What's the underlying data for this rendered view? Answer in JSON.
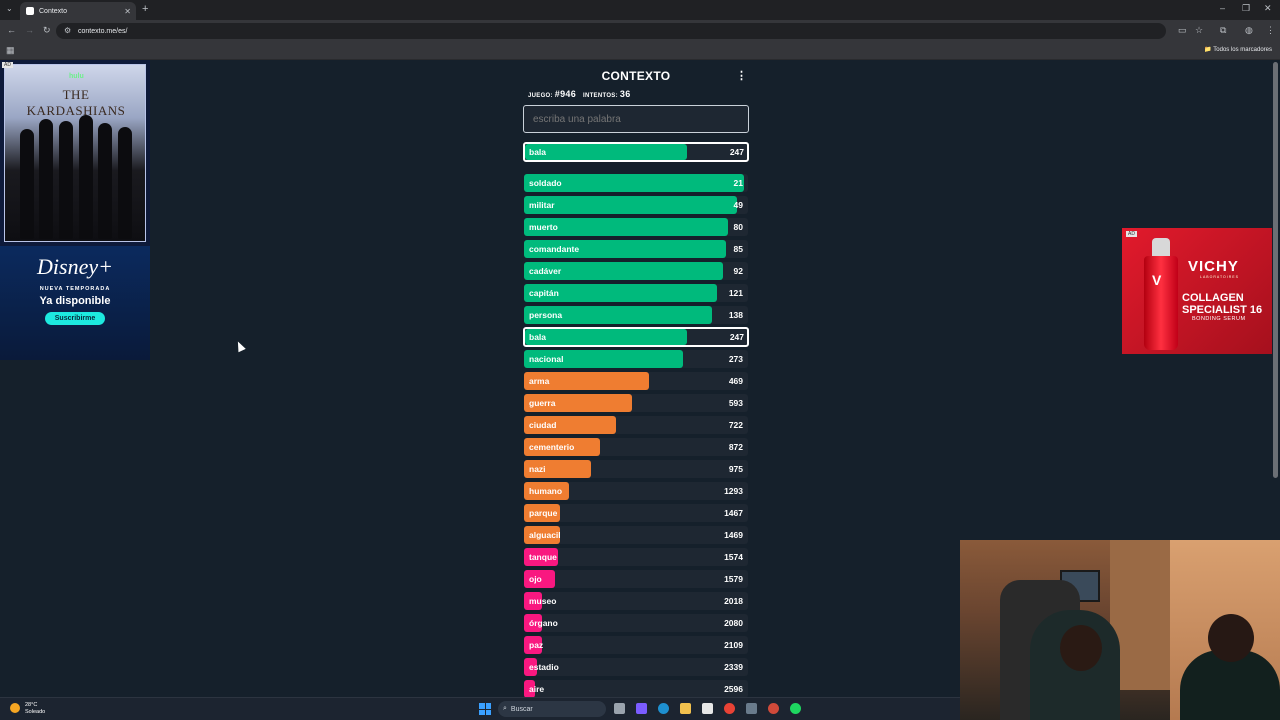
{
  "browser": {
    "tab_title": "Contexto",
    "url": "contexto.me/es/",
    "bookmarks_all": "Todos los marcadores"
  },
  "ads": {
    "left": {
      "tag": "AD",
      "brand": "hulu",
      "show": "THE KARDASHIANS",
      "service": "Disney+",
      "tagline": "NUEVA TEMPORADA",
      "headline": "Ya disponible",
      "cta": "Suscribirme"
    },
    "right": {
      "tag": "AD",
      "brand": "VICHY",
      "sub_brand": "LABORATOIRES",
      "product_line1": "COLLAGEN",
      "product_line2": "SPECIALIST 16",
      "product_line3": "BONDING SERUM",
      "bottle_mark": "V"
    }
  },
  "game": {
    "title": "CONTEXTO",
    "menu_icon": "more-vertical-icon",
    "game_label": "JUEGO:",
    "game_number": "#946",
    "attempts_label": "INTENTOS:",
    "attempts": "36",
    "input_placeholder": "escriba una palabra",
    "last_guess": {
      "word": "bala",
      "rank": "247",
      "fill": 0.73,
      "color": "#00ba7c"
    },
    "colors": {
      "green": "#00ba7c",
      "orange": "#ef7d31",
      "pink": "#f91880",
      "row_bg": "#1e2732"
    },
    "guesses": [
      {
        "word": "soldado",
        "rank": "21",
        "fill": 0.98,
        "color": "#00ba7c"
      },
      {
        "word": "militar",
        "rank": "49",
        "fill": 0.95,
        "color": "#00ba7c"
      },
      {
        "word": "muerto",
        "rank": "80",
        "fill": 0.91,
        "color": "#00ba7c"
      },
      {
        "word": "comandante",
        "rank": "85",
        "fill": 0.9,
        "color": "#00ba7c"
      },
      {
        "word": "cadáver",
        "rank": "92",
        "fill": 0.89,
        "color": "#00ba7c"
      },
      {
        "word": "capitán",
        "rank": "121",
        "fill": 0.86,
        "color": "#00ba7c"
      },
      {
        "word": "persona",
        "rank": "138",
        "fill": 0.84,
        "color": "#00ba7c"
      },
      {
        "word": "bala",
        "rank": "247",
        "fill": 0.73,
        "color": "#00ba7c",
        "current": true
      },
      {
        "word": "nacional",
        "rank": "273",
        "fill": 0.71,
        "color": "#00ba7c"
      },
      {
        "word": "arma",
        "rank": "469",
        "fill": 0.56,
        "color": "#ef7d31"
      },
      {
        "word": "guerra",
        "rank": "593",
        "fill": 0.48,
        "color": "#ef7d31"
      },
      {
        "word": "ciudad",
        "rank": "722",
        "fill": 0.41,
        "color": "#ef7d31"
      },
      {
        "word": "cementerio",
        "rank": "872",
        "fill": 0.34,
        "color": "#ef7d31"
      },
      {
        "word": "nazi",
        "rank": "975",
        "fill": 0.3,
        "color": "#ef7d31"
      },
      {
        "word": "humano",
        "rank": "1293",
        "fill": 0.2,
        "color": "#ef7d31"
      },
      {
        "word": "parque",
        "rank": "1467",
        "fill": 0.16,
        "color": "#ef7d31"
      },
      {
        "word": "alguacil",
        "rank": "1469",
        "fill": 0.16,
        "color": "#ef7d31"
      },
      {
        "word": "tanque",
        "rank": "1574",
        "fill": 0.15,
        "color": "#f91880"
      },
      {
        "word": "ojo",
        "rank": "1579",
        "fill": 0.14,
        "color": "#f91880"
      },
      {
        "word": "museo",
        "rank": "2018",
        "fill": 0.08,
        "color": "#f91880"
      },
      {
        "word": "órgano",
        "rank": "2080",
        "fill": 0.08,
        "color": "#f91880"
      },
      {
        "word": "paz",
        "rank": "2109",
        "fill": 0.08,
        "color": "#f91880"
      },
      {
        "word": "estadio",
        "rank": "2339",
        "fill": 0.06,
        "color": "#f91880"
      },
      {
        "word": "aire",
        "rank": "2596",
        "fill": 0.05,
        "color": "#f91880"
      }
    ]
  },
  "taskbar": {
    "temperature": "28°C",
    "weather": "Soleado",
    "search": "Buscar"
  }
}
